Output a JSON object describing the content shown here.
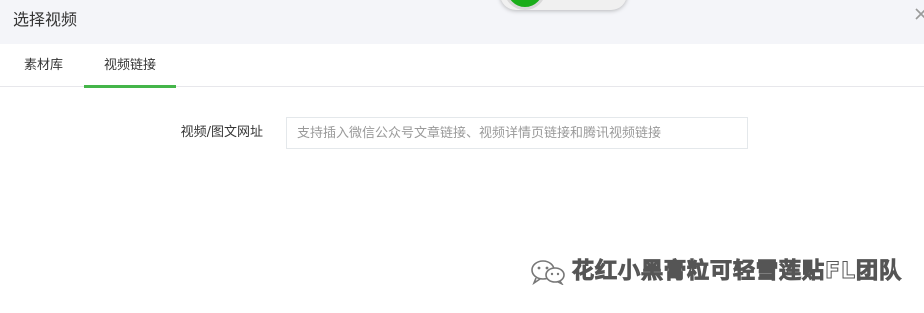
{
  "dialog": {
    "title": "选择视频",
    "close_icon": "close-icon"
  },
  "tabs": [
    {
      "label": "素材库",
      "active": false
    },
    {
      "label": "视频链接",
      "active": true
    }
  ],
  "form": {
    "url_label": "视频/图文网址",
    "url_value": "",
    "url_placeholder": "支持插入微信公众号文章链接、视频详情页链接和腾讯视频链接"
  },
  "watermark": {
    "icon": "wechat-icon",
    "text": "花红小黑膏粒可轻雪莲贴FL团队"
  },
  "colors": {
    "accent": "#44b549",
    "header_bg": "#f4f5f9",
    "text": "#353535",
    "placeholder": "#9a9a9a",
    "overlay_green": "#1aad19"
  }
}
